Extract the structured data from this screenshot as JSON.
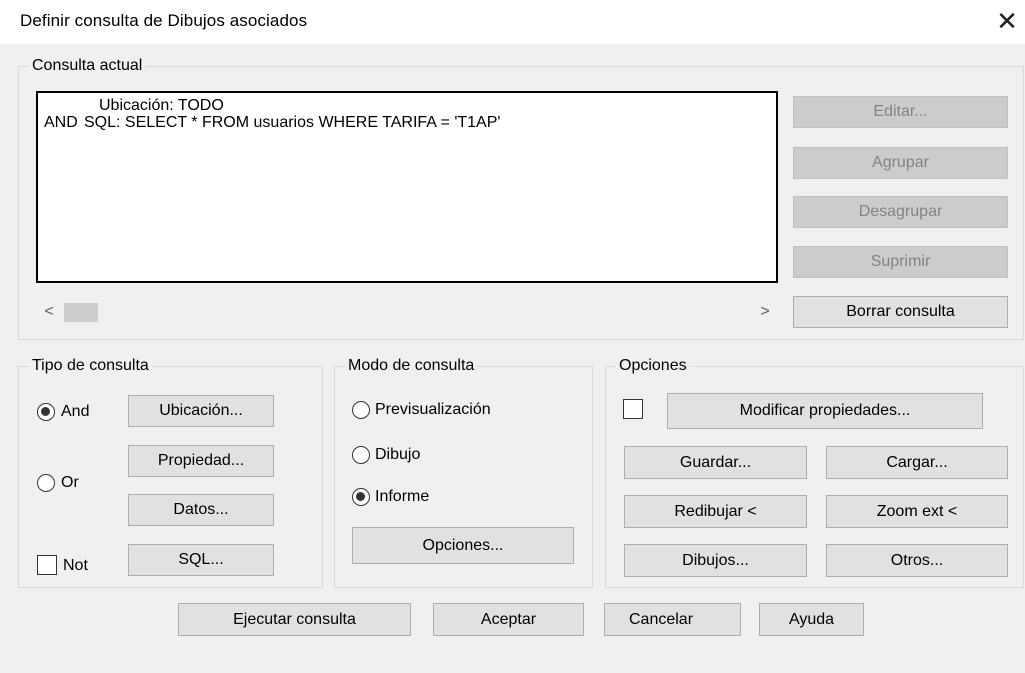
{
  "window": {
    "title": "Definir consulta de Dibujos asociados",
    "close_glyph": "✕"
  },
  "current_query": {
    "group_label": "Consulta actual",
    "lines": [
      {
        "op": "",
        "text": "Ubicación: TODO"
      },
      {
        "op": "AND",
        "text": "SQL: SELECT * FROM usuarios WHERE TARIFA = 'T1AP'"
      }
    ],
    "scroll_left": "<",
    "scroll_right": ">",
    "buttons": {
      "edit": "Editar...",
      "group": "Agrupar",
      "ungroup": "Desagrupar",
      "delete": "Suprimir",
      "clear": "Borrar consulta"
    }
  },
  "query_type": {
    "group_label": "Tipo de consulta",
    "and_label": "And",
    "or_label": "Or",
    "not_label": "Not",
    "and_checked": true,
    "or_checked": false,
    "not_checked": false,
    "buttons": {
      "location": "Ubicación...",
      "property": "Propiedad...",
      "data": "Datos...",
      "sql": "SQL..."
    }
  },
  "query_mode": {
    "group_label": "Modo de consulta",
    "preview_label": "Previsualización",
    "draw_label": "Dibujo",
    "report_label": "Informe",
    "selected": "report",
    "options_button": "Opciones..."
  },
  "options": {
    "group_label": "Opciones",
    "modify_checked": false,
    "buttons": {
      "modify_props": "Modificar propiedades...",
      "save": "Guardar...",
      "load": "Cargar...",
      "redraw": "Redibujar <",
      "zoom_ext": "Zoom ext <",
      "drawings": "Dibujos...",
      "others": "Otros..."
    }
  },
  "footer": {
    "execute": "Ejecutar consulta",
    "ok": "Aceptar",
    "cancel": "Cancelar",
    "help": "Ayuda"
  }
}
